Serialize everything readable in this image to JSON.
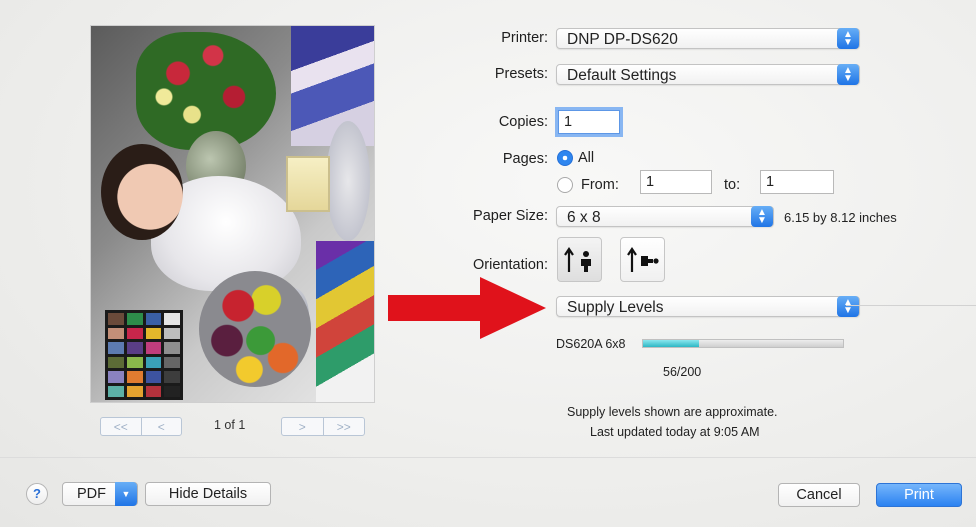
{
  "printer": {
    "label": "Printer:",
    "value": "DNP DP-DS620"
  },
  "presets": {
    "label": "Presets:",
    "value": "Default Settings"
  },
  "copies": {
    "label": "Copies:",
    "value": "1"
  },
  "pages": {
    "label": "Pages:",
    "all_label": "All",
    "from_label": "From:",
    "from_value": "1",
    "to_label": "to:",
    "to_value": "1",
    "selected": "All"
  },
  "paper_size": {
    "label": "Paper Size:",
    "value": "6 x 8",
    "dimensions": "6.15 by 8.12 inches"
  },
  "orientation": {
    "label": "Orientation:",
    "selected": "portrait",
    "icons": [
      "portrait-icon",
      "landscape-icon"
    ]
  },
  "panel_select": {
    "value": "Supply Levels"
  },
  "supply": {
    "item_label": "DS620A 6x8",
    "count_text": "56/200",
    "level_fraction": 0.28,
    "note": "Supply levels shown are approximate.",
    "updated": "Last updated today at 9:05 AM"
  },
  "preview": {
    "page_text": "1 of 1",
    "nav_first": "<<",
    "nav_prev": "<",
    "nav_next": ">",
    "nav_last": ">>"
  },
  "footer": {
    "help": "?",
    "pdf": "PDF",
    "hide_details": "Hide Details",
    "cancel": "Cancel",
    "print": "Print"
  },
  "colors": {
    "accent": "#2b82f1",
    "arrow": "#e0121b",
    "supply_fill": "#2db7c4"
  }
}
